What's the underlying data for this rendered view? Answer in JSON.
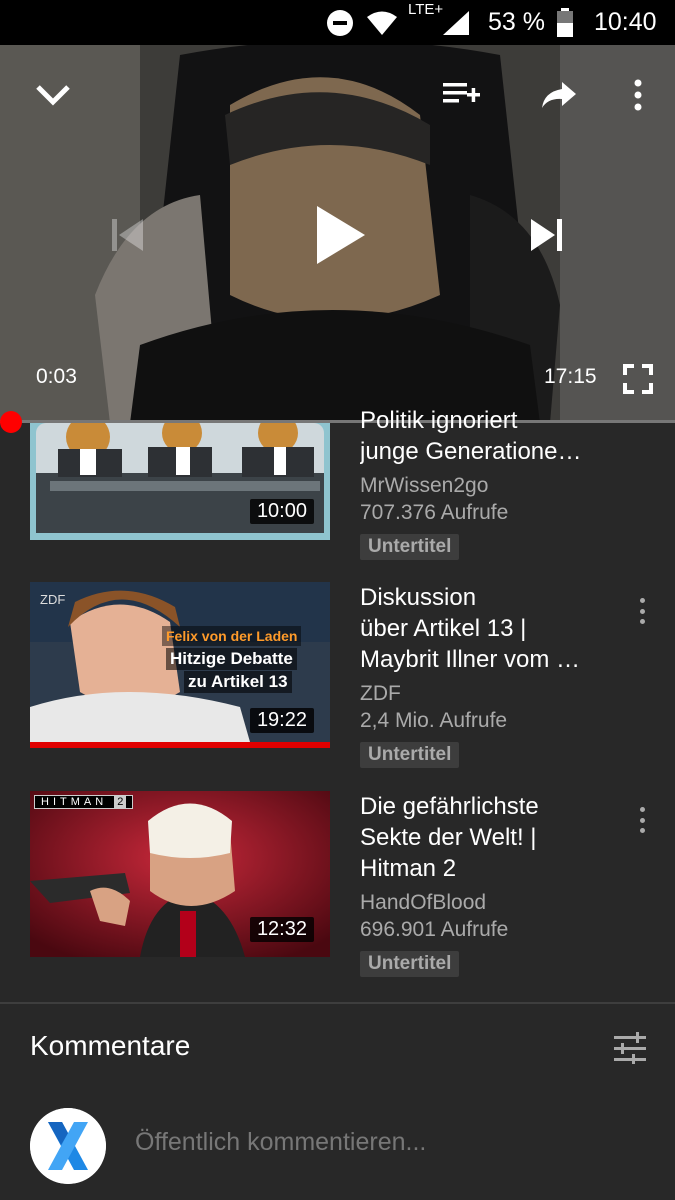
{
  "status_bar": {
    "network": "LTE+",
    "battery": "53 %",
    "time": "10:40"
  },
  "player": {
    "elapsed": "0:03",
    "duration": "17:15",
    "progress": 0.003
  },
  "videos": [
    {
      "title": "Politik ignoriert junge Generatione…",
      "title_line1": "Politik ignoriert",
      "title_line2": "junge Generatione…",
      "channel": "MrWissen2go",
      "views": "707.376 Aufrufe",
      "badge": "Untertitel",
      "duration": "10:00"
    },
    {
      "title": "Diskussion über Artikel 13 | Maybrit Illner vom …",
      "title_line1": "Diskussion",
      "title_line2": "über Artikel 13 |",
      "title_line3": "Maybrit Illner vom …",
      "channel": "ZDF",
      "views": "2,4 Mio. Aufrufe",
      "badge": "Untertitel",
      "duration": "19:22",
      "thumb_logo": "ZDF",
      "thumb_text1": "Felix von der Laden",
      "thumb_text2": "Hitzige Debatte",
      "thumb_text3": "zu Artikel 13"
    },
    {
      "title": "Die gefährlichste Sekte der Welt! | Hitman 2",
      "title_line1": "Die gefährlichste",
      "title_line2": "Sekte der Welt! |",
      "title_line3": "Hitman 2",
      "channel": "HandOfBlood",
      "views": "696.901 Aufrufe",
      "badge": "Untertitel",
      "duration": "12:32",
      "thumb_logo": "HITMAN",
      "thumb_logo_num": "2"
    }
  ],
  "comments": {
    "title": "Kommentare",
    "placeholder": "Öffentlich kommentieren..."
  },
  "colors": {
    "background": "#282828",
    "accent": "#ff0000",
    "secondary_text": "#aaaaaa"
  }
}
